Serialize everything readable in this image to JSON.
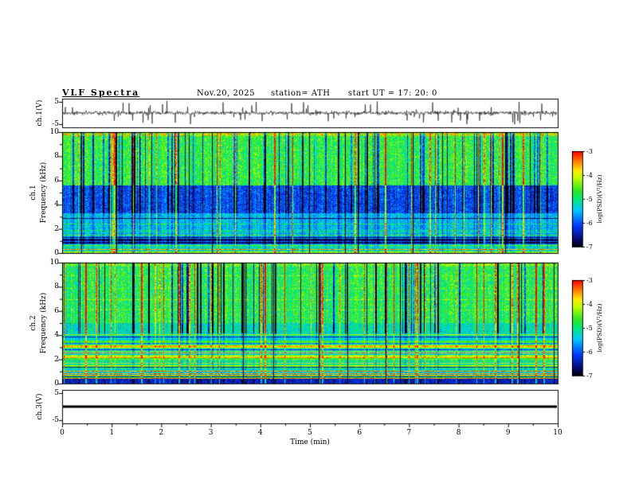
{
  "header": {
    "title": "VLF Spectra",
    "date": "Nov.20, 2025",
    "station": "station= ATH",
    "start_ut": "start UT =  17: 20: 0"
  },
  "panels": {
    "wave1": {
      "ylabel": "ch.1(V)",
      "yticks": [
        5,
        -5
      ]
    },
    "spec1": {
      "ylabel_line1": "ch.1",
      "ylabel_line2": "Frequency (kHz)",
      "yticks": [
        0,
        2,
        4,
        6,
        8,
        10
      ]
    },
    "spec2": {
      "ylabel_line1": "ch.2",
      "ylabel_line2": "Frequency (kHz)",
      "yticks": [
        0,
        2,
        4,
        6,
        8,
        10
      ]
    },
    "wave3": {
      "ylabel": "ch.3(V)",
      "yticks": [
        5,
        -5
      ]
    }
  },
  "xaxis": {
    "label": "Time (min)",
    "ticks": [
      0,
      1,
      2,
      3,
      4,
      5,
      6,
      7,
      8,
      9,
      10
    ]
  },
  "colorbar": {
    "label": "log(PSD)(V²/Hz)",
    "ticks": [
      -3,
      -4,
      -5,
      -6,
      -7
    ]
  },
  "chart_data": [
    {
      "panel": "ch1_timeseries",
      "type": "line",
      "ylabel": "ch.1(V)",
      "xlabel": "Time (min)",
      "xlim": [
        0,
        10
      ],
      "ylim": [
        -5,
        5
      ],
      "description": "Broadband noisy voltage trace centered on 0 V, typical excursion about ±1.5 V, with frequent impulsive sferic spikes reaching roughly ±5 V throughout the 10 minute record"
    },
    {
      "panel": "ch1_spectrogram",
      "type": "heatmap",
      "ylabel": "ch.1 Frequency (kHz)",
      "zlabel": "log(PSD)(V²/Hz)",
      "xlim": [
        0,
        10
      ],
      "ylim": [
        0,
        10
      ],
      "zlim": [
        -7,
        -3
      ],
      "colormap": "black-blue-cyan-green-yellow-red",
      "bands": [
        {
          "freq_khz": [
            9.7,
            10
          ],
          "mean_log_psd": -4.1,
          "note": "orange/red speckled cap at top edge"
        },
        {
          "freq_khz": [
            5.6,
            9.7
          ],
          "mean_log_psd": -4.8,
          "note": "green/yellow band crossed by vertical bright sferic streaks (to -3) and dark quiet streaks (to -7)"
        },
        {
          "freq_khz": [
            3.3,
            5.6
          ],
          "mean_log_psd": -6.1,
          "note": "dark blue band crossed by vertical streaks"
        },
        {
          "freq_khz": [
            1.4,
            3.3
          ],
          "mean_log_psd": -5.5,
          "note": "cyan band with horizontal interference lines"
        },
        {
          "freq_khz": [
            0.8,
            1.4
          ],
          "mean_log_psd": -6.7,
          "note": "near-black quiet band"
        },
        {
          "freq_khz": [
            0,
            0.8
          ],
          "mean_log_psd": -5.2,
          "note": "cyan/green lines near bottom edge"
        }
      ]
    },
    {
      "panel": "ch2_spectrogram",
      "type": "heatmap",
      "ylabel": "ch.2 Frequency (kHz)",
      "zlabel": "log(PSD)(V²/Hz)",
      "xlim": [
        0,
        10
      ],
      "ylim": [
        0,
        10
      ],
      "zlim": [
        -7,
        -3
      ],
      "colormap": "black-blue-cyan-green-yellow-red",
      "bands": [
        {
          "freq_khz": [
            5,
            10
          ],
          "mean_log_psd": -4.8,
          "note": "green band with dense near-black vertical streaks (to -7)"
        },
        {
          "freq_khz": [
            4,
            5
          ],
          "mean_log_psd": -5.2,
          "note": "cyan transition band"
        },
        {
          "freq_khz": [
            0.4,
            4
          ],
          "mean_log_psd": -5.35,
          "note": "dense horizontal striping; bright interference lines reach -3.5 (red/orange), dark lines drop to -6.5"
        },
        {
          "freq_khz": [
            0,
            0.4
          ],
          "mean_log_psd": -6.4,
          "note": "dark bottom edge"
        }
      ]
    },
    {
      "panel": "ch3_timeseries",
      "type": "line",
      "ylabel": "ch.3(V)",
      "xlabel": "Time (min)",
      "xlim": [
        0,
        10
      ],
      "ylim": [
        -5,
        5
      ],
      "description": "Flat thick line at 0 V for the whole 10 minute record (no signal on channel 3)"
    }
  ]
}
